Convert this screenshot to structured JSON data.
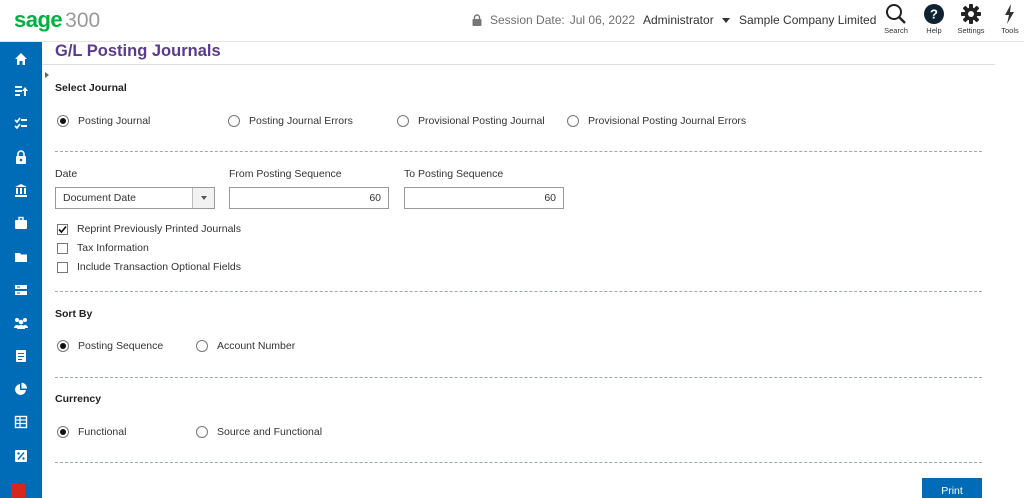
{
  "header": {
    "logo_brand": "sage",
    "logo_number": "300",
    "session_label": "Session Date:",
    "session_date": "Jul 06, 2022",
    "user": "Administrator",
    "company": "Sample Company Limited",
    "tools": [
      {
        "label": "Search",
        "icon": "search-icon"
      },
      {
        "label": "Help",
        "icon": "help-icon"
      },
      {
        "label": "Settings",
        "icon": "gear-icon"
      },
      {
        "label": "Tools",
        "icon": "lightning-icon"
      }
    ]
  },
  "sidebar": {
    "items": [
      "home-icon",
      "transactions-icon",
      "checklist-icon",
      "lock-icon",
      "bank-icon",
      "briefcase-icon",
      "folder-icon",
      "server-icon",
      "people-icon",
      "ledger-icon",
      "pie-chart-icon",
      "table-icon",
      "percent-icon"
    ]
  },
  "page": {
    "title": "G/L Posting Journals",
    "select_journal": {
      "title": "Select Journal",
      "options": [
        "Posting Journal",
        "Posting Journal Errors",
        "Provisional Posting Journal",
        "Provisional Posting Journal Errors"
      ],
      "selected": "Posting Journal"
    },
    "date": {
      "label": "Date",
      "value": "Document Date"
    },
    "from_seq": {
      "label": "From Posting Sequence",
      "value": "60"
    },
    "to_seq": {
      "label": "To Posting Sequence",
      "value": "60"
    },
    "checkboxes": [
      {
        "label": "Reprint Previously Printed Journals",
        "checked": true
      },
      {
        "label": "Tax Information",
        "checked": false
      },
      {
        "label": "Include Transaction Optional Fields",
        "checked": false
      }
    ],
    "sort_by": {
      "title": "Sort By",
      "options": [
        "Posting Sequence",
        "Account Number"
      ],
      "selected": "Posting Sequence"
    },
    "currency": {
      "title": "Currency",
      "options": [
        "Functional",
        "Source and Functional"
      ],
      "selected": "Functional"
    },
    "print_label": "Print"
  },
  "colors": {
    "brand_green": "#00b140",
    "sidebar_blue": "#006bb6",
    "title_purple": "#5c3a8e"
  }
}
